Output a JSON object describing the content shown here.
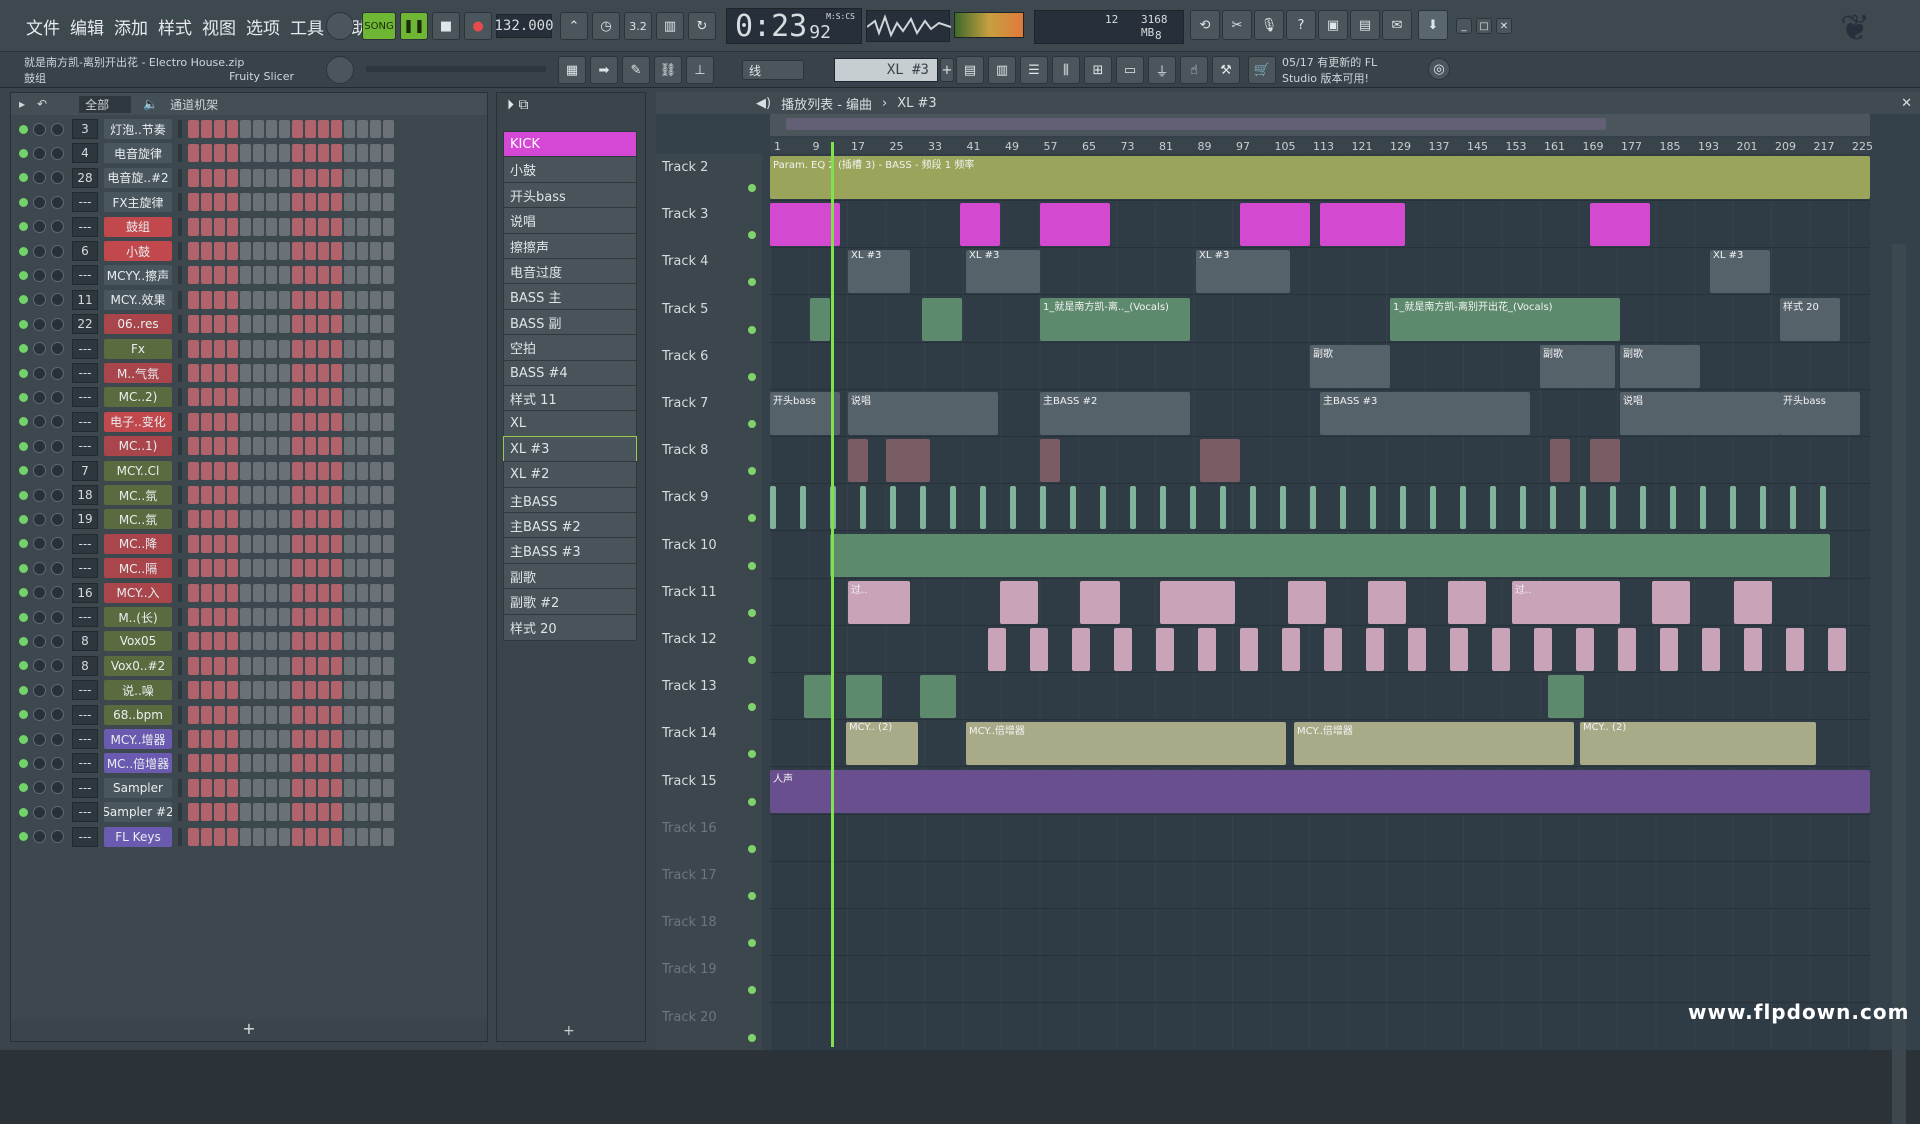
{
  "menu": [
    "文件",
    "编辑",
    "添加",
    "样式",
    "视图",
    "选项",
    "工具",
    "帮助"
  ],
  "transport": {
    "song_label": "SONG",
    "tempo": "132.000",
    "time": "0:23",
    "time_frac": "92",
    "time_unit": "M:S:CS"
  },
  "monitor": {
    "cpu": "12",
    "mem": "3168 MB",
    "poly": "8"
  },
  "project": {
    "title": "就是南方凯-离别开出花 - Electro House.zip",
    "channel": "鼓组",
    "plugin": "Fruity Slicer"
  },
  "pattern_selector": {
    "value": "XL #3"
  },
  "snap": {
    "value": "线"
  },
  "news": {
    "date": "05/17",
    "text1": "有更新的 FL",
    "text2": "Studio 版本可用!"
  },
  "rack": {
    "filter": "全部",
    "title": "通道机架",
    "rows": [
      {
        "num": "3",
        "name": "灯泡..节奏",
        "color": "#4a565d"
      },
      {
        "num": "4",
        "name": "电音旋律",
        "color": "#4a565d"
      },
      {
        "num": "28",
        "name": "电音旋..#2",
        "color": "#4a565d"
      },
      {
        "num": "---",
        "name": "FX主旋律",
        "color": "#4a565d"
      },
      {
        "num": "---",
        "name": "鼓组",
        "color": "#c1494d"
      },
      {
        "num": "6",
        "name": "小鼓",
        "color": "#c1494d"
      },
      {
        "num": "---",
        "name": "MCYY..擦声",
        "color": "#4a565d"
      },
      {
        "num": "11",
        "name": "MCY..效果",
        "color": "#4a565d"
      },
      {
        "num": "22",
        "name": "06..res",
        "color": "#a8464c"
      },
      {
        "num": "---",
        "name": "Fx",
        "color": "#5a6b3f"
      },
      {
        "num": "---",
        "name": "M..气氛",
        "color": "#a8464c"
      },
      {
        "num": "---",
        "name": "MC..2)",
        "color": "#5a6b3f"
      },
      {
        "num": "---",
        "name": "电子..变化",
        "color": "#c1494d"
      },
      {
        "num": "---",
        "name": "MC..1)",
        "color": "#a8464c"
      },
      {
        "num": "7",
        "name": "MCY..Cl",
        "color": "#5a6b3f"
      },
      {
        "num": "18",
        "name": "MC..氛",
        "color": "#5a6b3f"
      },
      {
        "num": "19",
        "name": "MC..氛",
        "color": "#5a6b3f"
      },
      {
        "num": "---",
        "name": "MC..降",
        "color": "#a8464c"
      },
      {
        "num": "---",
        "name": "MC..隔",
        "color": "#a8464c"
      },
      {
        "num": "16",
        "name": "MCY..入",
        "color": "#a8464c"
      },
      {
        "num": "---",
        "name": "M..(长)",
        "color": "#5a6b3f"
      },
      {
        "num": "8",
        "name": "Vox05",
        "color": "#5a6b3f"
      },
      {
        "num": "8",
        "name": "Vox0..#2",
        "color": "#5a6b3f"
      },
      {
        "num": "---",
        "name": "说..噪",
        "color": "#5a6b3f"
      },
      {
        "num": "---",
        "name": "68..bpm",
        "color": "#5a6b3f"
      },
      {
        "num": "---",
        "name": "MCY..增器",
        "color": "#6a5ab0"
      },
      {
        "num": "---",
        "name": "MC..倍增器",
        "color": "#6a5ab0"
      },
      {
        "num": "---",
        "name": "Sampler",
        "color": "#4a565d"
      },
      {
        "num": "---",
        "name": "Sampler #2",
        "color": "#4a565d"
      },
      {
        "num": "---",
        "name": "FL Keys",
        "color": "#6a5ab0"
      }
    ],
    "add_label": "+"
  },
  "patterns": [
    "KICK",
    "小鼓",
    "开头bass",
    "说唱",
    "擦擦声",
    "电音过度",
    "BASS 主",
    "BASS 副",
    "空拍",
    "BASS #4",
    "样式 11",
    "XL",
    "XL #3",
    "XL #2",
    "主BASS",
    "主BASS #2",
    "主BASS #3",
    "副歌",
    "副歌 #2",
    "样式 20"
  ],
  "playlist": {
    "header_title": "播放列表 - 编曲",
    "header_pattern": "XL #3",
    "ruler": [
      "1",
      "9",
      "17",
      "25",
      "33",
      "41",
      "49",
      "57",
      "65",
      "73",
      "81",
      "89",
      "97",
      "105",
      "113",
      "121",
      "129",
      "137",
      "145",
      "153",
      "161",
      "169",
      "177",
      "185",
      "193",
      "201",
      "209",
      "217",
      "225"
    ],
    "tracks": [
      "Track 2",
      "Track 3",
      "Track 4",
      "Track 5",
      "Track 6",
      "Track 7",
      "Track 8",
      "Track 9",
      "Track 10",
      "Track 11",
      "Track 12",
      "Track 13",
      "Track 14",
      "Track 15",
      "Track 16",
      "Track 17",
      "Track 18",
      "Track 19",
      "Track 20"
    ],
    "clips": {
      "t2": "Param. EQ 2 (插槽 3) - BASS - 频段 1 频率",
      "t4": "XL #3",
      "t5a": "1_就是南方凯-离.._(Vocals)",
      "t5b": "1_就是南方凯-离别开出花_(Vocals)",
      "t5c": "样式 20",
      "t6": "副歌",
      "t7a": "开头bass",
      "t7b": "说唱",
      "t7c": "主BASS #2",
      "t7d": "主BASS #3",
      "t11": "过..",
      "t14a": "MCY.. (2)",
      "t14b": "MCY..倍增器",
      "t15": "人声"
    }
  },
  "watermark": "www.flpdown.com"
}
